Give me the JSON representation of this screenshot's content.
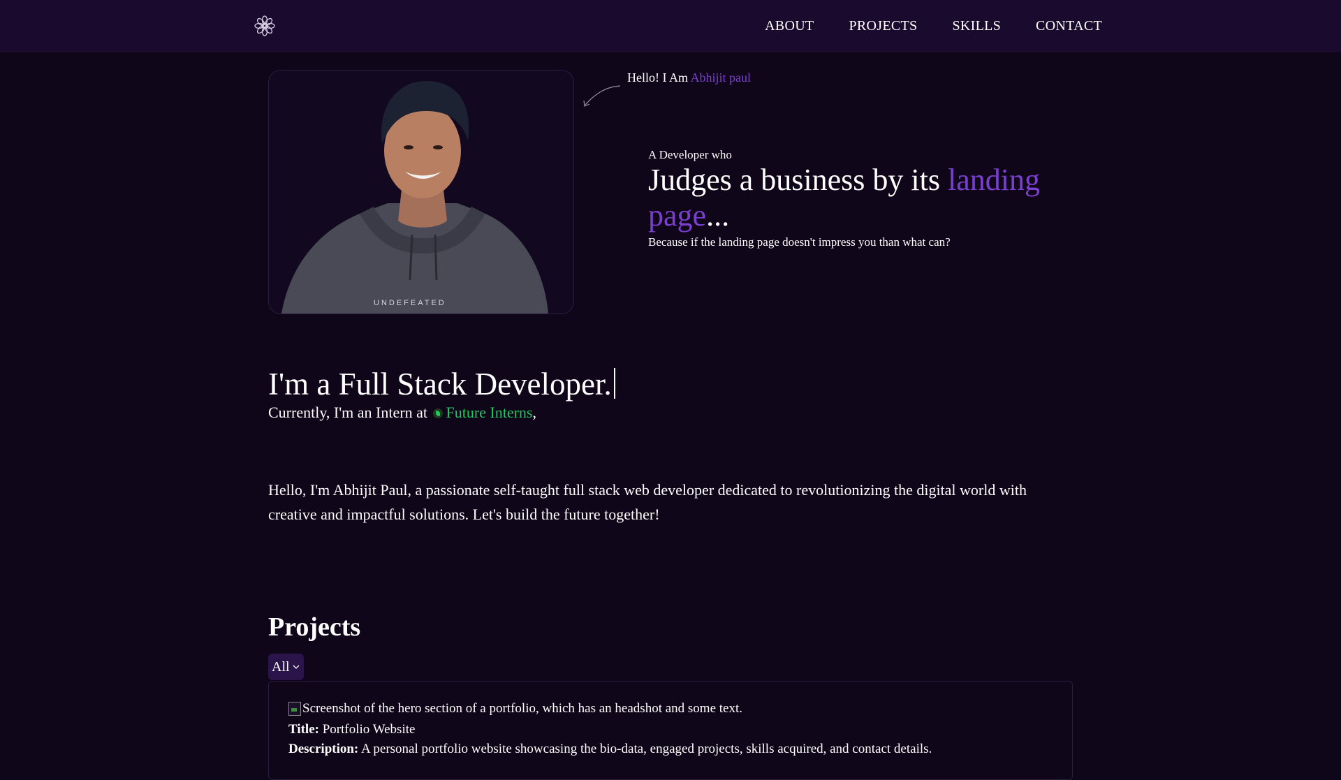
{
  "nav": {
    "logo_icon": "gear-flower-icon",
    "links": [
      "ABOUT",
      "PROJECTS",
      "SKILLS",
      "CONTACT"
    ]
  },
  "hero": {
    "hello_prefix": "Hello! I Am",
    "hello_name": "Abhijit paul",
    "developer_who": "A Developer who",
    "headline_main": "Judges a business by its ",
    "headline_accent": "landing page",
    "headline_suffix": "...",
    "because": "Because if the landing page doesn't impress you than what can?",
    "photo_caption": "UNDEFEATED"
  },
  "role": {
    "typed_text": "I'm a Full Stack Developer.",
    "intern_prefix": "Currently, I'm an Intern at",
    "company": "Future Interns",
    "intern_suffix": ","
  },
  "bio": "Hello, I'm Abhijit Paul, a passionate self-taught full stack web developer dedicated to revolutionizing the digital world with creative and impactful solutions. Let's build the future together!",
  "projects": {
    "title": "Projects",
    "filter_value": "All",
    "items": [
      {
        "image_alt": "Screenshot of the hero section of a portfolio, which has an headshot and some text.",
        "title_label": "Title:",
        "title": "Portfolio Website",
        "description_label": "Description:",
        "description": "A personal portfolio website showcasing the bio-data, engaged projects, skills acquired, and contact details."
      }
    ]
  },
  "colors": {
    "background": "#0f0619",
    "navbar": "#1a0b2e",
    "accent_purple": "#7b3fd0",
    "accent_green": "#22c55e"
  }
}
